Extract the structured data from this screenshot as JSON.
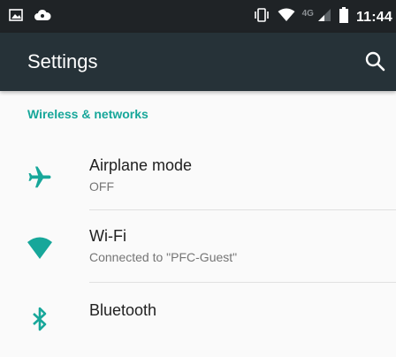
{
  "status_bar": {
    "network_type": "4G",
    "time": "11:44"
  },
  "app_bar": {
    "title": "Settings"
  },
  "section": {
    "header": "Wireless & networks"
  },
  "items": [
    {
      "title": "Airplane mode",
      "summary": "OFF",
      "icon": "airplane-icon"
    },
    {
      "title": "Wi-Fi",
      "summary": "Connected to \"PFC-Guest\"",
      "icon": "wifi-icon"
    },
    {
      "title": "Bluetooth",
      "summary": "",
      "icon": "bluetooth-icon"
    }
  ],
  "colors": {
    "status_bar": "#1f2326",
    "app_bar": "#263238",
    "accent": "#17a79a",
    "background": "#fafafa"
  }
}
